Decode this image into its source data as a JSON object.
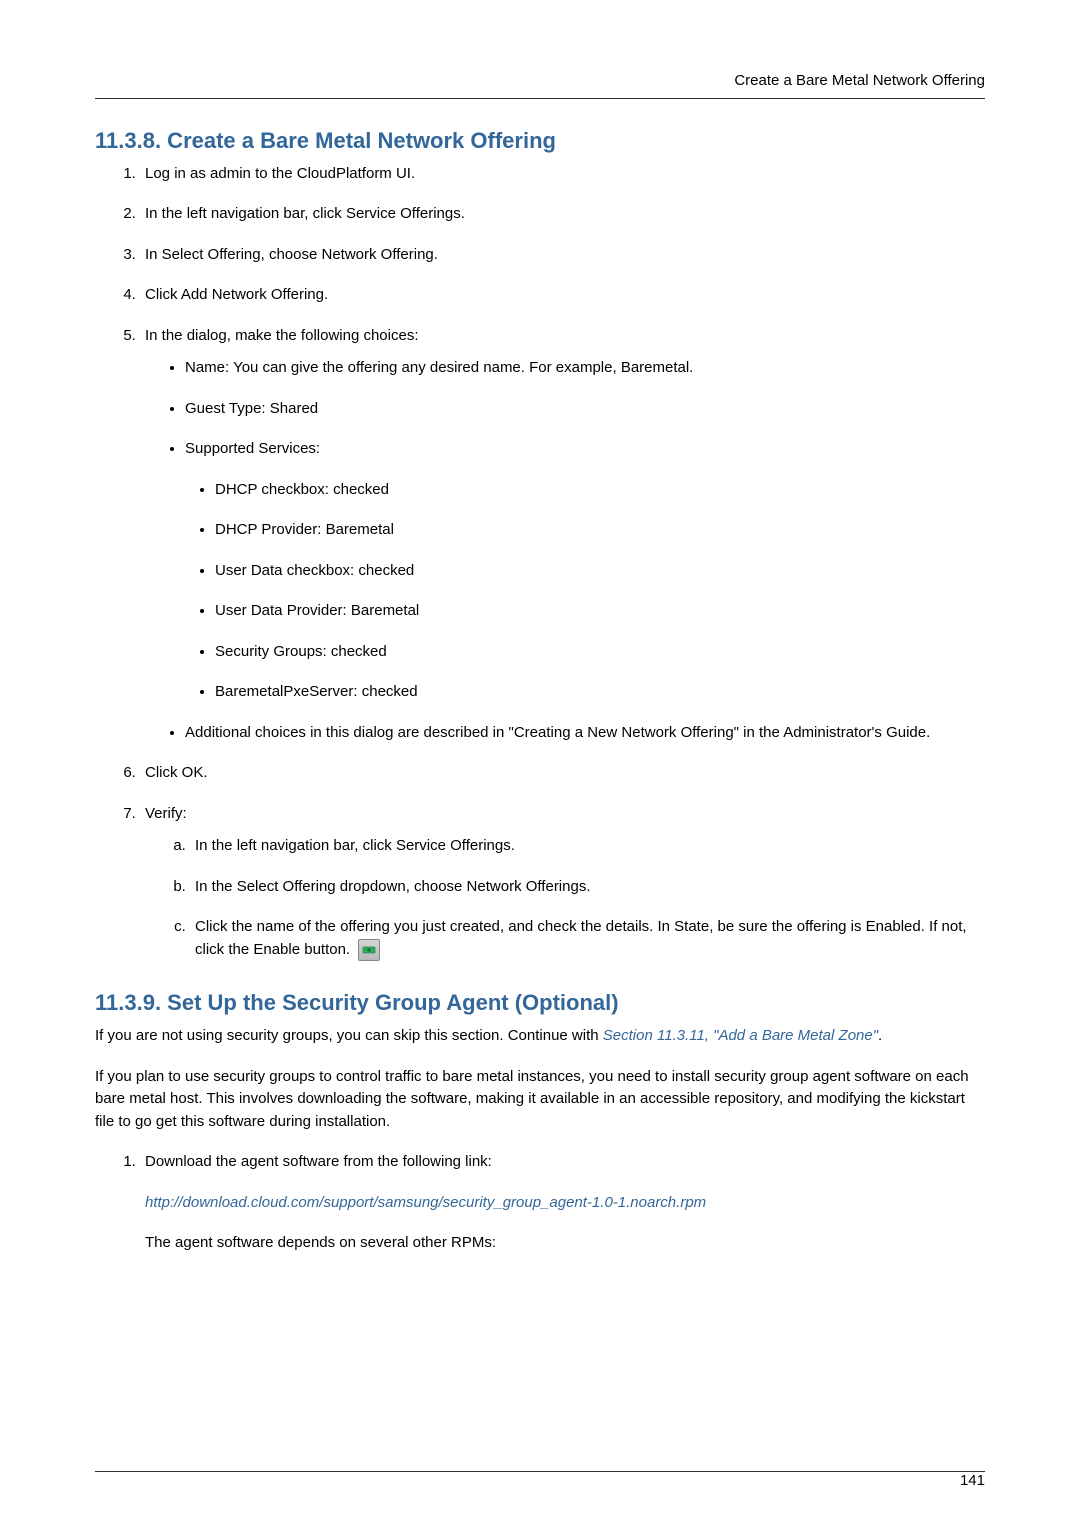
{
  "header": {
    "title": "Create a Bare Metal Network Offering"
  },
  "section1": {
    "number_title": "11.3.8. Create a Bare Metal Network Offering",
    "steps": {
      "s1": "Log in as admin to the CloudPlatform UI.",
      "s2": "In the left navigation bar, click Service Offerings.",
      "s3": "In Select Offering, choose Network Offering.",
      "s4": "Click Add Network Offering.",
      "s5": "In the dialog, make the following choices:",
      "s5_bullets": {
        "b1": "Name: You can give the offering any desired name. For example, Baremetal.",
        "b2": "Guest Type: Shared",
        "b3": "Supported Services:",
        "b3_sub": {
          "s1": "DHCP checkbox: checked",
          "s2": "DHCP Provider: Baremetal",
          "s3": "User Data checkbox: checked",
          "s4": "User Data Provider: Baremetal",
          "s5": "Security Groups: checked",
          "s6": "BaremetalPxeServer: checked"
        },
        "b4": "Additional choices in this dialog are described in \"Creating a New Network Offering\" in the Administrator's Guide."
      },
      "s6": "Click OK.",
      "s7": "Verify:",
      "s7_sub": {
        "a": "In the left navigation bar, click Service Offerings.",
        "b": "In the Select Offering dropdown, choose Network Offerings.",
        "c_part1": "Click the name of the offering you just created, and check the details. In State, be sure the offering is Enabled. If not, click the Enable button."
      }
    }
  },
  "section2": {
    "number_title": "11.3.9. Set Up the Security Group Agent (Optional)",
    "p1_part1": "If you are not using security groups, you can skip this section. Continue with ",
    "p1_link": "Section 11.3.11, \"Add a Bare Metal Zone\"",
    "p1_part2": ".",
    "p2": "If you plan to use security groups to control traffic to bare metal instances, you need to install security group agent software on each bare metal host. This involves downloading the software, making it available in an accessible repository, and modifying the kickstart file to go get this software during installation.",
    "step1": "Download the agent software from the following link:",
    "step1_link": "http://download.cloud.com/support/samsung/security_group_agent-1.0-1.noarch.rpm",
    "step1_after": "The agent software depends on several other RPMs:"
  },
  "footer": {
    "page": "141"
  }
}
